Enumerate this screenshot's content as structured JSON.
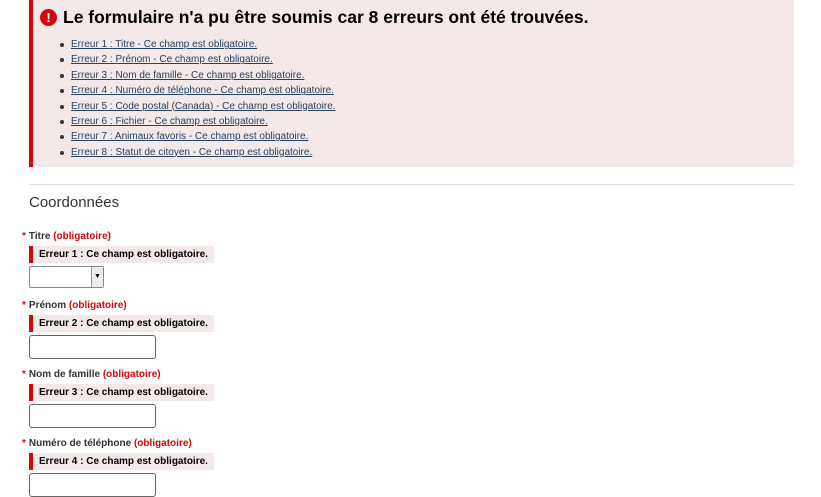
{
  "error_summary": {
    "title": "Le formulaire n'a pu être soumis car 8 erreurs ont été trouvées.",
    "icon": "exclamation-circle-icon",
    "accent_color": "#d3080c",
    "items": [
      "Erreur 1 : Titre - Ce champ est obligatoire.",
      "Erreur 2 : Prénom - Ce champ est obligatoire.",
      "Erreur 3 : Nom de famille - Ce champ est obligatoire.",
      "Erreur 4 : Numéro de téléphone - Ce champ est obligatoire.",
      "Erreur 5 : Code postal (Canada) - Ce champ est obligatoire.",
      "Erreur 6 : Fichier - Ce champ est obligatoire.",
      "Erreur 7 : Animaux favoris - Ce champ est obligatoire.",
      "Erreur 8 : Statut de citoyen - Ce champ est obligatoire."
    ]
  },
  "section": {
    "legend": "Coordonnées"
  },
  "fields": [
    {
      "marker": "*",
      "label": "Titre",
      "required": "(obligatoire)",
      "error": "Erreur 1 : Ce champ est obligatoire.",
      "type": "select",
      "value": ""
    },
    {
      "marker": "*",
      "label": "Prénom",
      "required": "(obligatoire)",
      "error": "Erreur 2 : Ce champ est obligatoire.",
      "type": "text",
      "value": ""
    },
    {
      "marker": "*",
      "label": "Nom de famille",
      "required": "(obligatoire)",
      "error": "Erreur 3 : Ce champ est obligatoire.",
      "type": "text",
      "value": ""
    },
    {
      "marker": "*",
      "label": "Numéro de téléphone",
      "required": "(obligatoire)",
      "error": "Erreur 4 : Ce champ est obligatoire.",
      "type": "text",
      "value": ""
    }
  ]
}
